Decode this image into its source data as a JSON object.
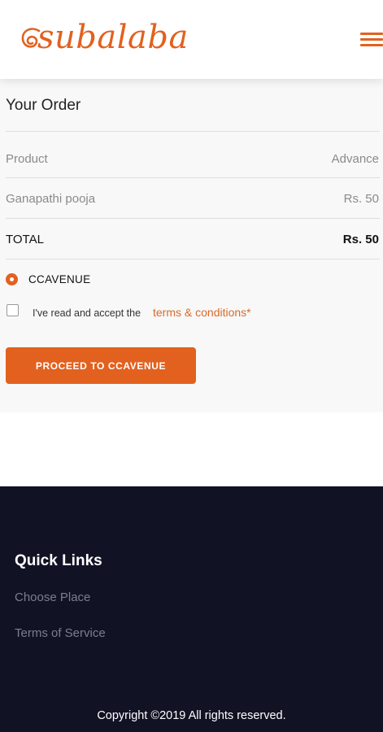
{
  "header": {
    "logo_text": "subalaba",
    "menu_icon": "hamburger-menu-icon",
    "brand_color": "#e2611f"
  },
  "order": {
    "title": "Your Order",
    "columns": {
      "product": "Product",
      "advance": "Advance"
    },
    "item": {
      "name": "Ganapathi pooja",
      "price": "Rs. 50"
    },
    "total": {
      "label": "TOTAL",
      "amount": "Rs. 50"
    },
    "payment_method": "CCAVENUE",
    "terms": {
      "text": "I've read and accept the",
      "link": "terms & conditions*",
      "checked": false
    },
    "proceed_label": "PROCEED TO CCAVENUE"
  },
  "footer": {
    "quick_links_title": "Quick Links",
    "links": [
      "Choose Place",
      "Terms of Service"
    ],
    "copyright": "Copyright ©2019 All rights reserved.",
    "background": "#111224"
  }
}
